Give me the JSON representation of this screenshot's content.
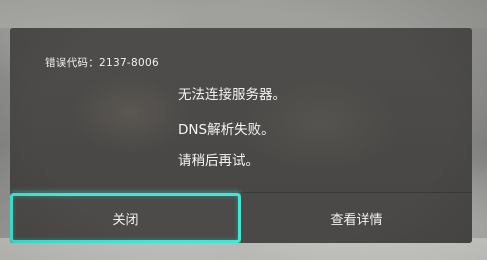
{
  "dialog": {
    "error_code": "错误代码：2137-8006",
    "messages": [
      "无法连接服务器。",
      "DNS解析失败。",
      "请稍后再试。"
    ],
    "buttons": {
      "close": "关闭",
      "details": "查看详情"
    }
  },
  "colors": {
    "dialog_bg": "#4a4948",
    "focus_ring": "#3ee8d8",
    "text": "#f2f2f2"
  }
}
